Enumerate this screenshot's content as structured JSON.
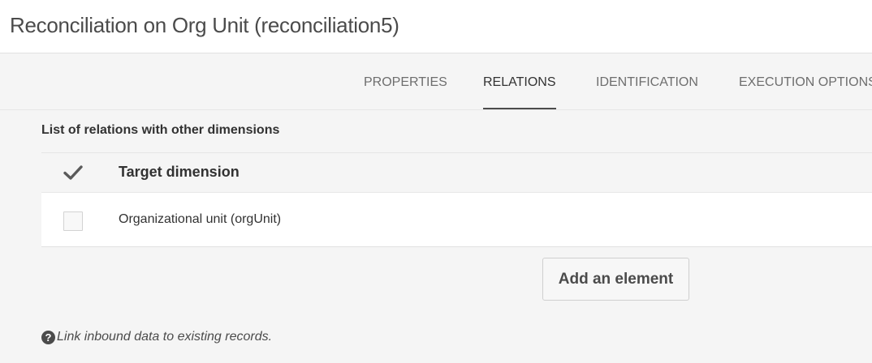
{
  "header": {
    "title": "Reconciliation on Org Unit (reconciliation5)"
  },
  "tabs": [
    {
      "label": "PROPERTIES",
      "active": false
    },
    {
      "label": "RELATIONS",
      "active": true
    },
    {
      "label": "IDENTIFICATION",
      "active": false
    },
    {
      "label": "EXECUTION OPTIONS",
      "active": false
    }
  ],
  "relations": {
    "section_label": "List of relations with other dimensions",
    "column_header": "Target dimension",
    "rows": [
      {
        "label": "Organizational unit (orgUnit)",
        "checked": false
      }
    ],
    "add_button_label": "Add an element"
  },
  "help": {
    "icon": "question-circle-icon",
    "text": "Link inbound data to existing records."
  },
  "colors": {
    "background": "#f5f5f5",
    "surface": "#ffffff",
    "text": "#323232",
    "active_tab_underline": "#4b4b4b"
  }
}
